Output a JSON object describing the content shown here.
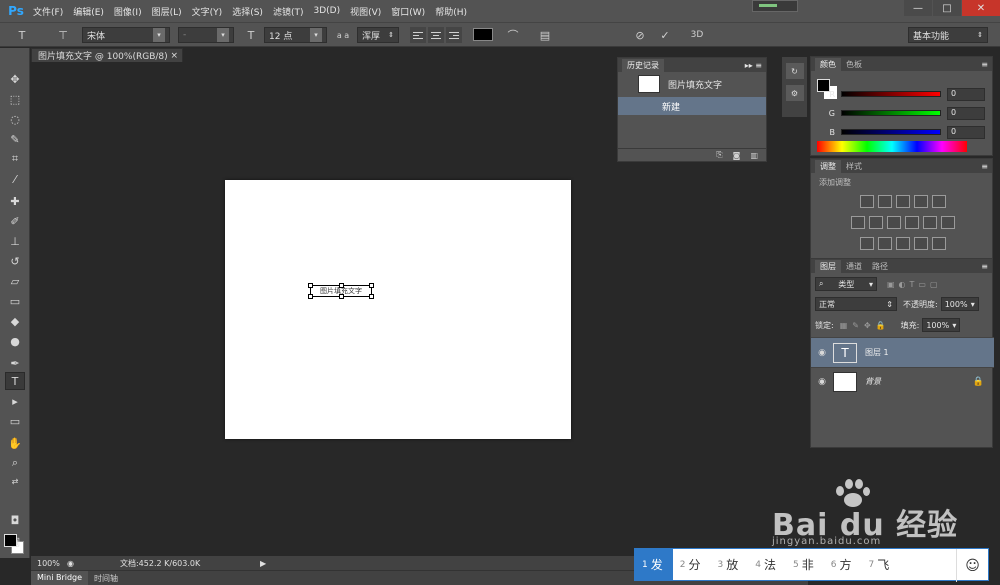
{
  "app": {
    "logo": "Ps"
  },
  "menu": [
    "文件(F)",
    "编辑(E)",
    "图像(I)",
    "图层(L)",
    "文字(Y)",
    "选择(S)",
    "滤镜(T)",
    "3D(D)",
    "视图(V)",
    "窗口(W)",
    "帮助(H)"
  ],
  "window_controls": {
    "minimize": "—",
    "maximize": "□",
    "close": "✕"
  },
  "options": {
    "tool_icon": "T",
    "font_family": "宋体",
    "font_style": "-",
    "font_size": "12 点",
    "aa_label": "a a",
    "antialias": "浑厚",
    "threed": "3D",
    "workspace": "基本功能"
  },
  "document": {
    "tab_title": "图片填充文字 @ 100%(RGB/8)",
    "tab_close": "×",
    "text_content": "图片填充文字",
    "zoom": "100%",
    "doc_info": "文档:452.2 K/603.0K"
  },
  "bottom_tabs": [
    "Mini Bridge",
    "时间轴"
  ],
  "history": {
    "tabs": [
      "历史记录"
    ],
    "snapshot_label": "图片填充文字",
    "state_label": "新建"
  },
  "color_panel": {
    "tabs": [
      "颜色",
      "色板"
    ],
    "channels": [
      {
        "label": "R",
        "value": "0"
      },
      {
        "label": "G",
        "value": "0"
      },
      {
        "label": "B",
        "value": "0"
      }
    ]
  },
  "adjust_panel": {
    "tabs": [
      "调整",
      "样式"
    ],
    "subtitle": "添加调整"
  },
  "layers_panel": {
    "tabs": [
      "图层",
      "通道",
      "路径"
    ],
    "filter": "类型",
    "blend_mode": "正常",
    "opacity_label": "不透明度:",
    "opacity": "100%",
    "lock_label": "锁定:",
    "fill_label": "填充:",
    "fill": "100%",
    "layers": [
      {
        "name": "图层 1",
        "thumb": "T"
      },
      {
        "name": "背景",
        "thumb": ""
      }
    ]
  },
  "ime": {
    "candidates": [
      {
        "n": "1",
        "text": "发"
      },
      {
        "n": "2",
        "text": "分"
      },
      {
        "n": "3",
        "text": "放"
      },
      {
        "n": "4",
        "text": "法"
      },
      {
        "n": "5",
        "text": "非"
      },
      {
        "n": "6",
        "text": "方"
      },
      {
        "n": "7",
        "text": "飞"
      }
    ],
    "emoji": "☺"
  },
  "watermark": {
    "main": "Bai du 经验",
    "sub": "jingyan.baidu.com"
  }
}
